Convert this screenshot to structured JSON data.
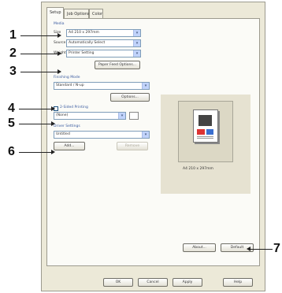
{
  "tabs": [
    "Setup",
    "Job Options",
    "Color"
  ],
  "media": {
    "group_title": "Media",
    "size_label": "Size",
    "size_value": "A4 210 x 297mm",
    "source_label": "Source",
    "source_value": "Automatically Select",
    "weight_label": "Weight",
    "weight_value": "Printer Setting",
    "paper_feed_button": "Paper Feed Options..."
  },
  "finishing": {
    "group_title": "Finishing Mode",
    "value": "Standard / N-up",
    "options_button": "Options..."
  },
  "output": {
    "group_title": "2-Sided Printing",
    "value": "(None)"
  },
  "driver_settings": {
    "group_title": "Driver Settings",
    "value": "Untitled",
    "add_button": "Add...",
    "remove_button": "Remove"
  },
  "preview": {
    "caption": "A4 210 x 297mm"
  },
  "about_button": "About...",
  "default_button": "Default",
  "footer": {
    "ok": "OK",
    "cancel": "Cancel",
    "apply": "Apply",
    "help": "Help"
  },
  "callouts": [
    "1",
    "2",
    "3",
    "4",
    "5",
    "6",
    "7"
  ]
}
